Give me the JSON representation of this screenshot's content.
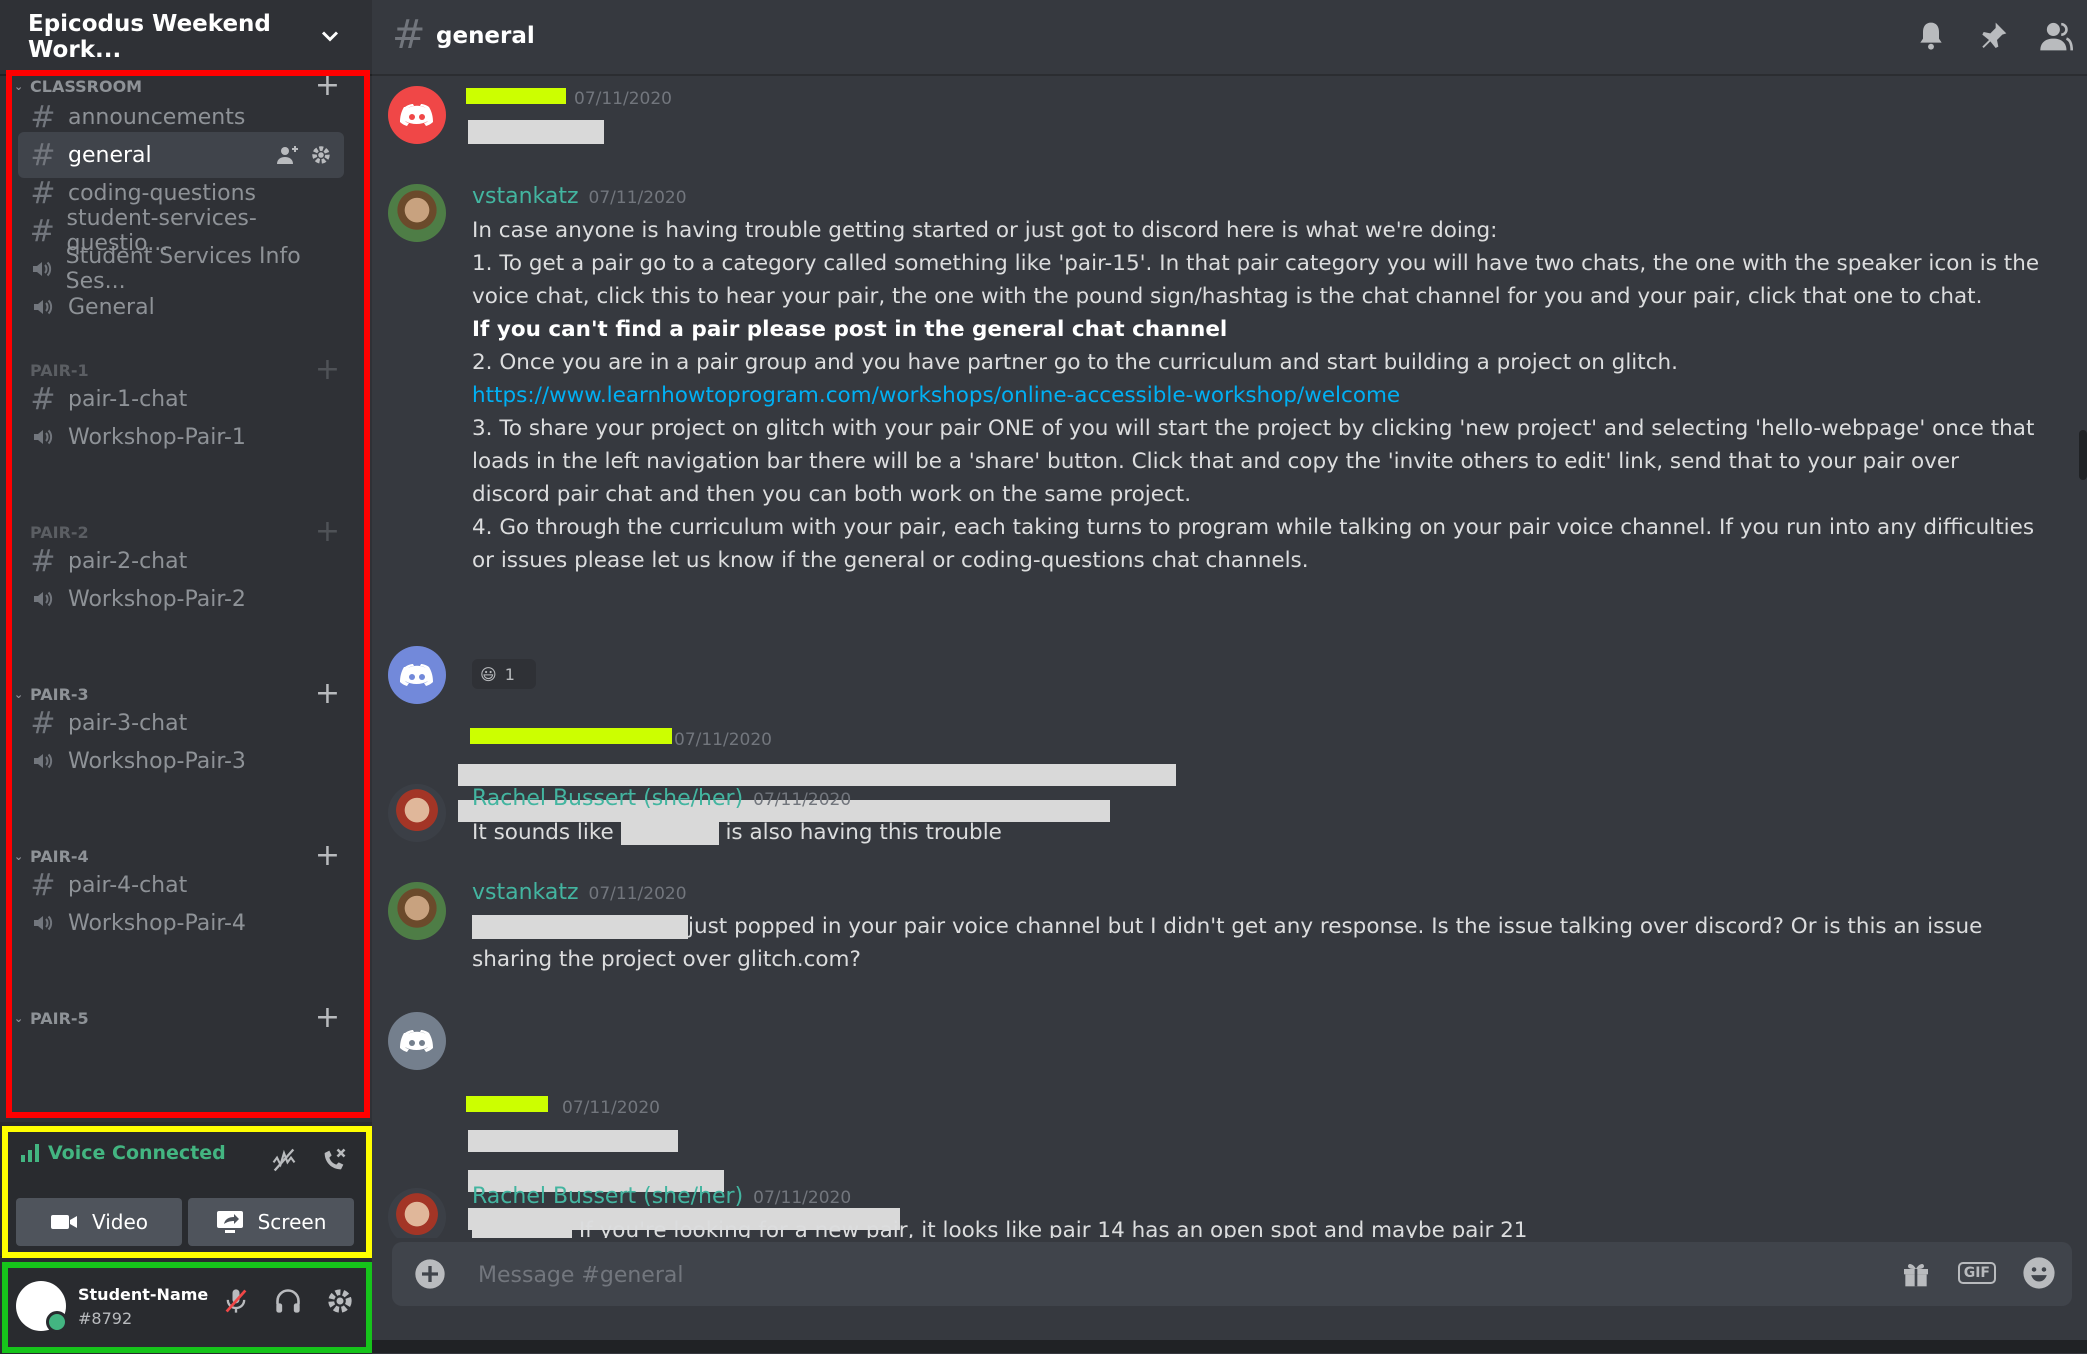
{
  "server": {
    "name": "Epicodus Weekend Work..."
  },
  "categories": [
    {
      "name": "CLASSROOM"
    },
    {
      "name": "PAIR-1"
    },
    {
      "name": "PAIR-2"
    },
    {
      "name": "PAIR-3"
    },
    {
      "name": "PAIR-4"
    },
    {
      "name": "PAIR-5"
    }
  ],
  "channels": [
    {
      "name": "announcements",
      "type": "text"
    },
    {
      "name": "general",
      "type": "text",
      "selected": true
    },
    {
      "name": "coding-questions",
      "type": "text"
    },
    {
      "name": "student-services-questio...",
      "type": "text"
    },
    {
      "name": "Student Services Info Ses...",
      "type": "voice"
    },
    {
      "name": "General",
      "type": "voice"
    },
    {
      "name": "pair-1-chat",
      "type": "text"
    },
    {
      "name": "Workshop-Pair-1",
      "type": "voice"
    },
    {
      "name": "pair-2-chat",
      "type": "text"
    },
    {
      "name": "Workshop-Pair-2",
      "type": "voice"
    },
    {
      "name": "pair-3-chat",
      "type": "text"
    },
    {
      "name": "Workshop-Pair-3",
      "type": "voice"
    },
    {
      "name": "pair-4-chat",
      "type": "text"
    },
    {
      "name": "Workshop-Pair-4",
      "type": "voice"
    }
  ],
  "voice": {
    "status": "Voice Connected",
    "video_label": "Video",
    "screen_label": "Screen"
  },
  "user": {
    "name": "Student-Name",
    "tag": "#8792"
  },
  "header": {
    "channel": "general"
  },
  "messages": [
    {
      "author": "",
      "timestamp": "07/11/2020"
    },
    {
      "author": "vstankatz",
      "timestamp": "07/11/2020",
      "lines": {
        "l1": "In case anyone is having trouble getting started or just got to discord here is what we're doing:",
        "l2": "1. To get a pair go to a category called something like 'pair-15'. In that pair category you will have two chats, the one with the speaker icon is the voice chat, click this to hear your pair, the one with the pound sign/hashtag is the chat channel for you and your pair, click that one to chat.",
        "l3": "If you can't find a pair please post in the general chat channel",
        "l4": "2. Once you are in a pair group and you have partner go to the curriculum and start building a project on glitch.",
        "l5": "https://www.learnhowtoprogram.com/workshops/online-accessible-workshop/welcome",
        "l6": "3. To share your project on glitch with your pair ONE of you will start the project by clicking 'new project' and selecting 'hello-webpage' once that loads in the left navigation bar there will be a 'share' button. Click that and copy the 'invite others to edit' link, send that to your pair over discord pair chat and then you can both work on the same project.",
        "l7": "4. Go through the curriculum with your pair, each taking turns to program while talking on your pair voice channel. If you run into any difficulties or issues please let us know if the general or coding-questions chat channels."
      },
      "reaction": {
        "emoji": "😃",
        "count": "1"
      }
    },
    {
      "author": "",
      "timestamp": "07/11/2020"
    },
    {
      "author": "Rachel Bussert (she/her)",
      "timestamp": "07/11/2020",
      "text_a": "It sounds like",
      "text_b": "is also having this trouble"
    },
    {
      "author": "vstankatz",
      "timestamp": "07/11/2020",
      "text": "just popped in your pair voice channel but I didn't get any response. Is the issue talking over discord? Or is this an issue sharing the project over glitch.com?"
    },
    {
      "author": "",
      "timestamp": "07/11/2020"
    },
    {
      "author": "Rachel Bussert (she/her)",
      "timestamp": "07/11/2020",
      "text": "If you're looking for a new pair, it looks like pair 14 has an open spot and maybe pair 21"
    }
  ],
  "composer": {
    "placeholder": "Message #general"
  },
  "icons": {
    "header": [
      "bell-icon",
      "pin-icon",
      "members-icon"
    ],
    "composer": [
      "add-attachment-icon",
      "gift-icon",
      "gif-icon",
      "emoji-icon"
    ]
  },
  "colors": {
    "sidebar": "#2f3136",
    "main": "#36393f",
    "accent_green": "#43b581",
    "author": "#43b5a0",
    "link": "#00b0f4",
    "highlight_red": "#ff0000",
    "highlight_yellow": "#ffff00",
    "highlight_green": "#16c41b"
  }
}
